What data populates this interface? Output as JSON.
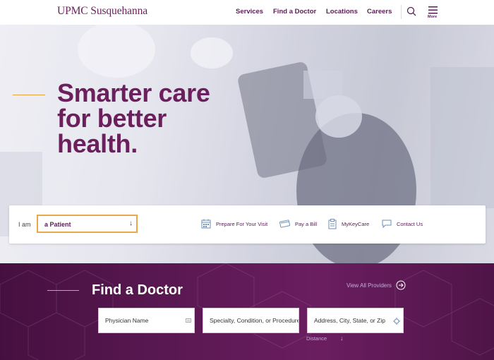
{
  "header": {
    "logo": "UPMC Susquehanna",
    "nav": [
      "Services",
      "Find a Doctor",
      "Locations",
      "Careers"
    ],
    "more_label": "More"
  },
  "hero": {
    "title_lines": [
      "Smarter care",
      "for better",
      "health."
    ]
  },
  "quickbar": {
    "iam_label": "I am",
    "role_selected": "a Patient",
    "actions": [
      {
        "label": "Prepare For Your Visit",
        "icon": "calendar-icon"
      },
      {
        "label": "Pay a Bill",
        "icon": "credit-card-icon"
      },
      {
        "label": "MyKeyCare",
        "icon": "clipboard-icon"
      },
      {
        "label": "Contact Us",
        "icon": "chat-bubble-icon"
      }
    ]
  },
  "find_doctor": {
    "title": "Find a Doctor",
    "view_all": "View All Providers",
    "physician_placeholder": "Physician Name",
    "specialty_placeholder": "Specialty, Condition, or Procedure",
    "address_placeholder": "Address, City, State, or Zip",
    "distance_label": "Distance"
  },
  "colors": {
    "brand_purple": "#6b1f5c",
    "accent_gold": "#e9a84a",
    "fad_background": "#5a1852"
  }
}
